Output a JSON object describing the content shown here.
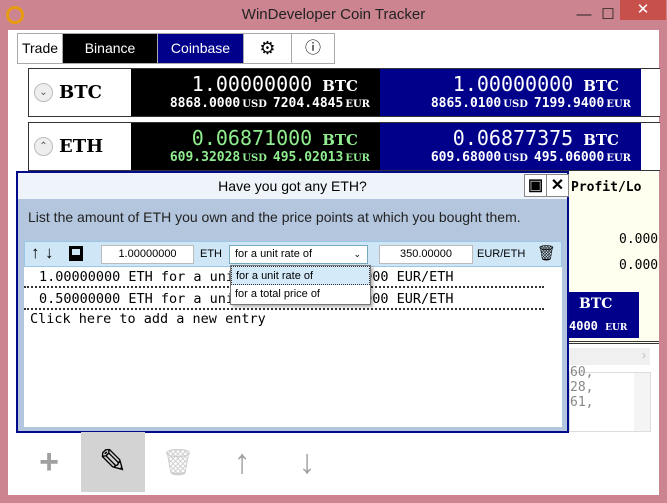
{
  "window": {
    "title": "WinDeveloper Coin Tracker",
    "min": "—",
    "max": "☐",
    "close": "✕"
  },
  "tabs": [
    {
      "label": "Trade"
    },
    {
      "label": "Binance"
    },
    {
      "label": "Coinbase"
    },
    {
      "label": "⚙"
    },
    {
      "label": "ⓘ"
    }
  ],
  "coins": [
    {
      "symbol": "BTC",
      "chevron": "⌄",
      "binance": {
        "amount": "1.00000000",
        "unit": "BTC",
        "usd": "8868.0000",
        "eur": "7204.4845"
      },
      "coinbase": {
        "amount": "1.00000000",
        "unit": "BTC",
        "usd": "8865.0100",
        "eur": "7199.9400"
      }
    },
    {
      "symbol": "ETH",
      "chevron": "⌃",
      "binance": {
        "amount": "0.06871000",
        "unit": "BTC",
        "usd": "609.32028",
        "eur": "495.02013"
      },
      "coinbase": {
        "amount": "0.06877375",
        "unit": "BTC",
        "usd": "609.68000",
        "eur": "495.06000"
      }
    }
  ],
  "currency": {
    "usd": "USD",
    "eur": "EUR"
  },
  "background": {
    "profit_header": "Profit/Lo",
    "profit_values": [
      "0.000",
      "0.000"
    ],
    "btc_label": "BTC",
    "btc_eur": "4000",
    "eur": "EUR",
    "log_lines": [
      "60,",
      "28,",
      "61,"
    ]
  },
  "dialog": {
    "title": "Have you got any ETH?",
    "instruction": "List the amount of ETH you own and the price points at which you bought them.",
    "edit": {
      "amount": "1.00000000",
      "amount_unit": "ETH",
      "mode": "for a unit rate of",
      "price": "350.00000",
      "price_unit": "EUR/ETH"
    },
    "dropdown_options": [
      "for a unit rate of",
      "for a total price of"
    ],
    "entries": [
      "1.00000000 ETH for a unit rate of 350.00000 EUR/ETH",
      "0.50000000 ETH for a unit rate of 400.00000 EUR/ETH"
    ],
    "add_entry": "Click here to add a new entry"
  },
  "toolbar": {
    "add": "+",
    "edit": "✎",
    "delete": "🗑",
    "up": "↑",
    "down": "↓"
  },
  "colors": {
    "binance": "#000000",
    "coinbase": "#00008b",
    "positive": "#90ee90",
    "frame": "#cc8590"
  }
}
